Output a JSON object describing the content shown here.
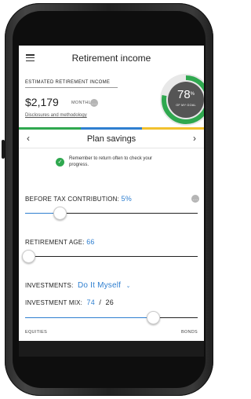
{
  "header": {
    "title": "Retirement income"
  },
  "estimate": {
    "label": "ESTIMATED RETIREMENT INCOME",
    "amount": "$2,179",
    "period": "MONTHLY",
    "info_icon": "…",
    "disclosures": "Disclosures and methodology"
  },
  "goal": {
    "percent": "78",
    "percent_sign": "%",
    "label": "OF MY GOAL",
    "fraction": 0.78,
    "color": "#2fa84f"
  },
  "color_bar": [
    "#2fa84f",
    "#2f7fd0",
    "#f2c12e"
  ],
  "plan": {
    "prev_icon": "‹",
    "next_icon": "›",
    "title": "Plan savings"
  },
  "reminder": {
    "check_icon": "✓",
    "text": "Remember to return often to check your progress."
  },
  "contribution": {
    "label": "BEFORE TAX CONTRIBUTION:",
    "value": "5%",
    "level": 0.2
  },
  "retirement_age": {
    "label": "RETIREMENT AGE:",
    "value": "66",
    "level": 0.02
  },
  "investments": {
    "label": "INVESTMENTS:",
    "value": "Do It Myself",
    "chevron_icon": "⌄"
  },
  "mix": {
    "label": "INVESTMENT MIX:",
    "equities_value": "74",
    "separator": "/",
    "bonds_value": "26",
    "level": 0.74,
    "left_label": "EQUITIES",
    "right_label": "BONDS"
  },
  "colors": {
    "accent": "#2f7fd0"
  }
}
